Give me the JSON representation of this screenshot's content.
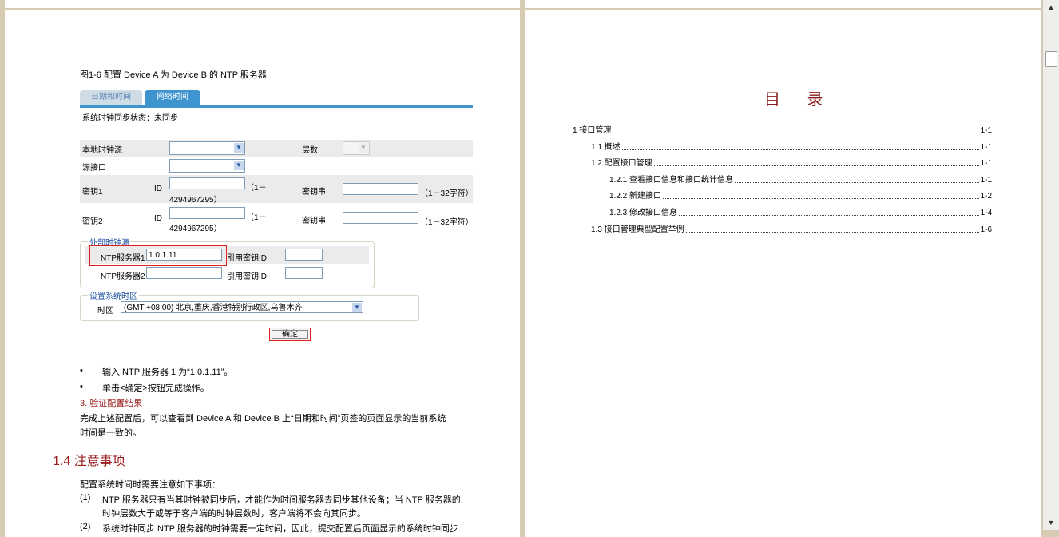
{
  "left_page": {
    "figure_caption": "图1-6  配置 Device A 为 Device B 的 NTP 服务器",
    "tabs": [
      "日期和时间",
      "网络时间"
    ],
    "sync_status": "系统时钟同步状态：未同步",
    "form": {
      "local_clock_label": "本地时钟源",
      "stratum_label": "层数",
      "source_iface_label": "源接口",
      "key1_label": "密钥1",
      "key2_label": "密钥2",
      "id_label": "ID",
      "id_range_a": "（1－",
      "id_range_b": "4294967295）",
      "key_string_label": "密钥串",
      "key_string_range": "（1－32字符）",
      "external_clock_legend": "外部时钟源",
      "ntp_server1_label": "NTP服务器1",
      "ntp_server1_value": "1.0.1.11",
      "ntp_server2_label": "NTP服务器2",
      "ntp_server2_value": "",
      "ref_key_label": "引用密钥ID",
      "timezone_legend": "设置系统时区",
      "timezone_label": "时区",
      "timezone_value": "(GMT +08:00) 北京,重庆,香港特别行政区,乌鲁木齐",
      "ok_button": "确定"
    },
    "bullets": [
      "输入 NTP 服务器 1 为“1.0.1.11”。",
      "单击<确定>按钮完成操作。"
    ],
    "verify_heading": "3. 验证配置结果",
    "verify_text_1": "完成上述配置后，可以查看到 Device A 和 Device B 上“日期和时间”页签的页面显示的当前系统",
    "verify_text_2": "时间是一致的。",
    "section_heading": "1.4  注意事项",
    "notes_intro": "配置系统时间时需要注意如下事项：",
    "note1_num": "(1)",
    "note1_line1": "NTP 服务器只有当其时钟被同步后，才能作为时间服务器去同步其他设备；当 NTP 服务器的",
    "note1_line2": "时钟层数大于或等于客户端的时钟层数时，客户端将不会向其同步。",
    "note2_num": "(2)",
    "note2_line1": "系统时钟同步 NTP 服务器的时钟需要一定时间，因此，提交配置后页面显示的系统时钟同步"
  },
  "right_page": {
    "toc_title": "目 录",
    "toc": [
      {
        "title": "1 接口管理",
        "page": "1-1",
        "level": 0
      },
      {
        "title": "1.1 概述",
        "page": "1-1",
        "level": 1
      },
      {
        "title": "1.2 配置接口管理",
        "page": "1-1",
        "level": 1
      },
      {
        "title": "1.2.1 查看接口信息和接口统计信息",
        "page": "1-1",
        "level": 2
      },
      {
        "title": "1.2.2 新建接口",
        "page": "1-2",
        "level": 2
      },
      {
        "title": "1.2.3 修改接口信息",
        "page": "1-4",
        "level": 2
      },
      {
        "title": "1.3 接口管理典型配置举例",
        "page": "1-6",
        "level": 1
      }
    ]
  }
}
